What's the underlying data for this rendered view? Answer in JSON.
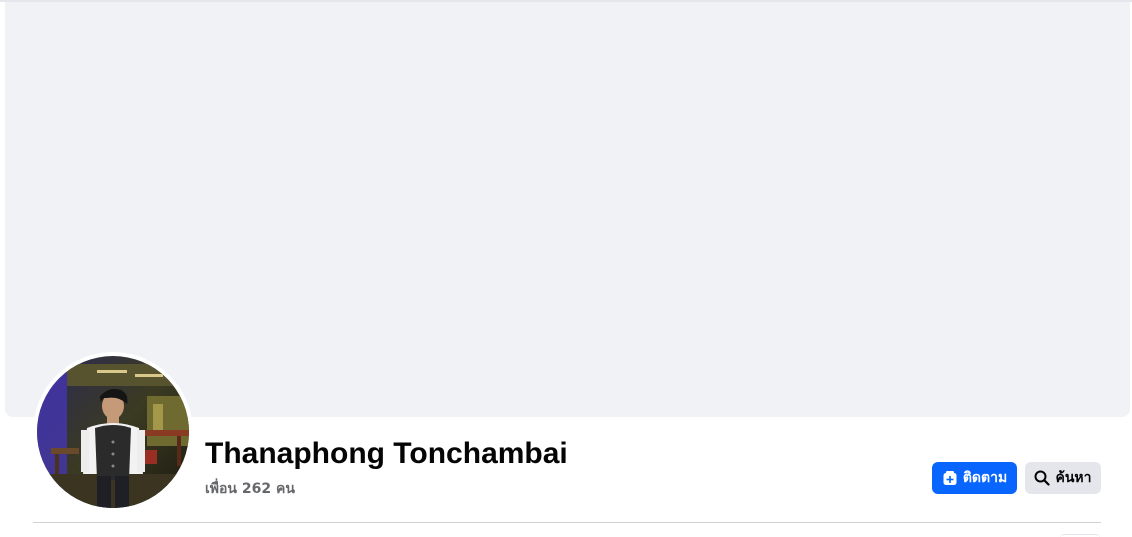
{
  "profile": {
    "name": "Thanaphong Tonchambai",
    "friends": "เพื่อน 262 คน"
  },
  "actions": {
    "follow_label": "ติดตาม",
    "follow_icon": "follow-plus-icon",
    "search_label": "ค้นหา",
    "search_icon": "magnifier-icon"
  },
  "colors": {
    "primary": "#0866ff",
    "cover": "#f0f2f5",
    "secondary_button": "#e4e6eb",
    "muted_text": "#65676b"
  }
}
